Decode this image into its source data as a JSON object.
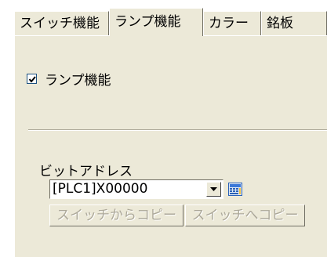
{
  "tabs": [
    {
      "label": "スイッチ機能",
      "active": false
    },
    {
      "label": "ランプ機能",
      "active": true
    },
    {
      "label": "カラー",
      "active": false
    },
    {
      "label": "銘板",
      "active": false
    }
  ],
  "lamp_checkbox": {
    "label": "ランプ機能",
    "checked": true
  },
  "bit_address": {
    "label": "ビットアドレス",
    "value": "[PLC1]X00000"
  },
  "buttons": {
    "copy_from_switch": "スイッチからコピー",
    "copy_to_switch": "スイッチへコピー"
  },
  "icons": {
    "address_input_icon": "keypad-icon",
    "dropdown_icon": "chevron-down-icon",
    "check_icon": "checkmark-icon"
  },
  "colors": {
    "panel_bg": "#ece9d8",
    "disabled_text": "#aca899"
  }
}
